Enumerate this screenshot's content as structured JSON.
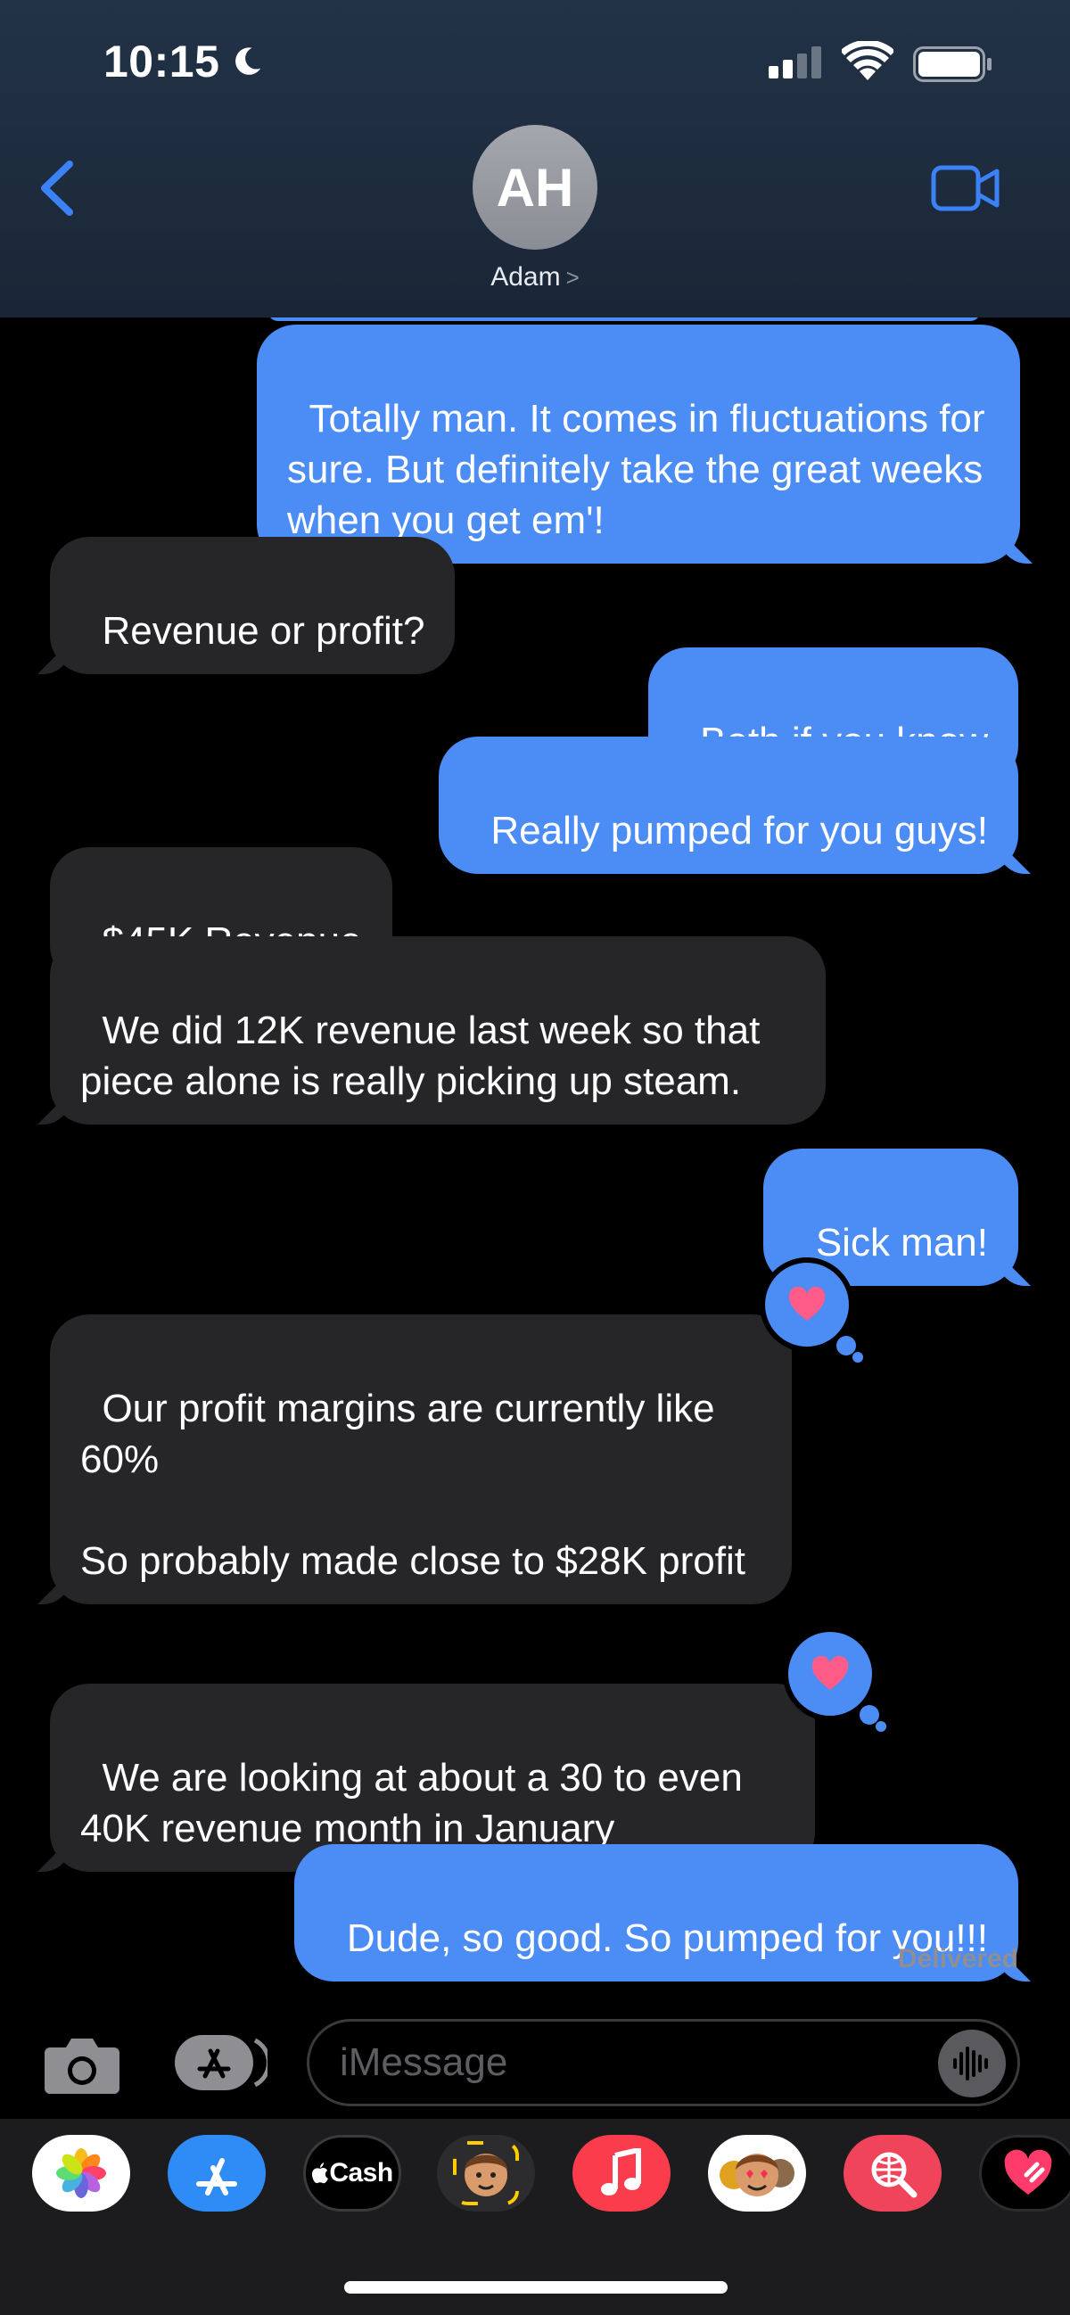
{
  "status_bar": {
    "time": "10:15"
  },
  "header": {
    "avatar_initials": "AH",
    "contact_name": "Adam"
  },
  "messages": [
    {
      "from": "me",
      "text": "Totally man. It comes in fluctuations for sure. But definitely take the great weeks when you get em'!"
    },
    {
      "from": "them",
      "text": "Revenue or profit?"
    },
    {
      "from": "me",
      "text": "Both if you know"
    },
    {
      "from": "me",
      "text": "Really pumped for you guys!"
    },
    {
      "from": "them",
      "text": "$45K Revenue"
    },
    {
      "from": "them",
      "text": "We did 12K revenue last week so that piece alone is really picking up steam."
    },
    {
      "from": "me",
      "text": "Sick man!"
    },
    {
      "from": "them",
      "text": "Our profit margins are currently like 60%\n\nSo probably made close to $28K profit",
      "reaction": "heart"
    },
    {
      "from": "them",
      "text": "We are looking at about a 30 to even 40K revenue month in January",
      "reaction": "heart"
    },
    {
      "from": "me",
      "text": "Dude, so good. So pumped for you!!!"
    }
  ],
  "delivered_label": "Delivered",
  "composer": {
    "placeholder": "iMessage"
  },
  "app_drawer": {
    "apps": [
      "Photos",
      "App Store",
      "Apple Cash",
      "Memoji",
      "Music",
      "Memoji Stickers",
      "Images Search",
      "Digital Touch"
    ],
    "cash_label": "Cash"
  },
  "colors": {
    "sent_bubble": "#4b8cf5",
    "received_bubble": "#262629",
    "accent": "#3b82f6",
    "heart": "#ff5c8a"
  }
}
